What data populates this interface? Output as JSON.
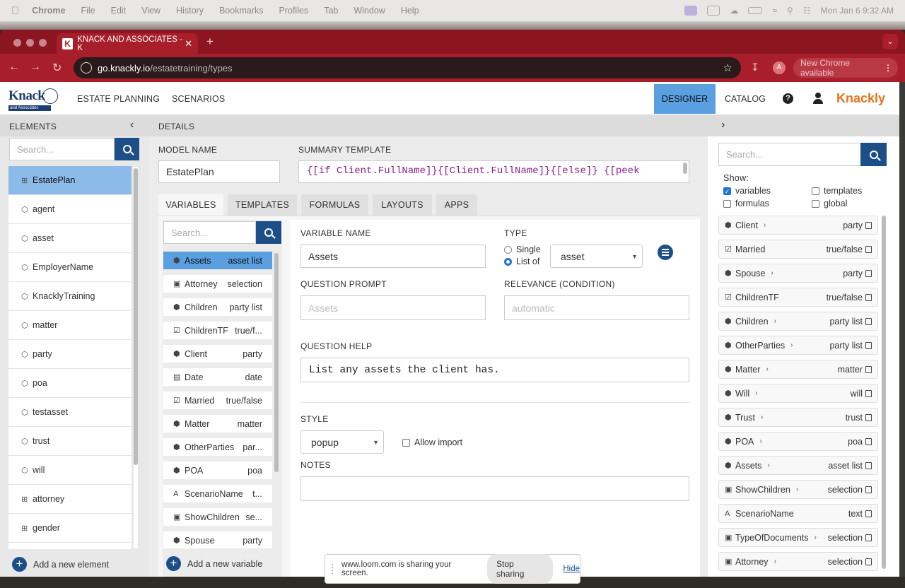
{
  "mac_menu": {
    "app": "Chrome",
    "items": [
      "File",
      "Edit",
      "View",
      "History",
      "Bookmarks",
      "Profiles",
      "Tab",
      "Window",
      "Help"
    ],
    "clock": "Mon Jan 6  9:32 AM"
  },
  "browser": {
    "tab_title": "KNACK AND ASSOCIATES - K",
    "tab_favicon": "K",
    "url_host": "go.knackly.io",
    "url_path": "/estatetraining/types",
    "avatar": "A",
    "update_label": "New Chrome available"
  },
  "header": {
    "logo_main": "Knack",
    "logo_sub": "and Associates",
    "nav": [
      "ESTATE PLANNING",
      "SCENARIOS"
    ],
    "designer": "DESIGNER",
    "catalog": "CATALOG",
    "help": "?",
    "brand": "Knackly"
  },
  "colors": {
    "accent": "#1c4e87",
    "selected": "#5a9fe0",
    "brand": "#e8721c",
    "chrome": "#a81e2a"
  },
  "left": {
    "title": "ELEMENTS",
    "search_placeholder": "Search...",
    "items": [
      {
        "icon": "table-icon",
        "label": "EstatePlan",
        "selected": true
      },
      {
        "icon": "cube-icon",
        "label": "agent"
      },
      {
        "icon": "cube-icon",
        "label": "asset"
      },
      {
        "icon": "cube-icon",
        "label": "EmployerName"
      },
      {
        "icon": "cube-icon",
        "label": "KnacklyTraining"
      },
      {
        "icon": "cube-icon",
        "label": "matter"
      },
      {
        "icon": "cube-icon",
        "label": "party"
      },
      {
        "icon": "cube-icon",
        "label": "poa"
      },
      {
        "icon": "cube-icon",
        "label": "testasset"
      },
      {
        "icon": "cube-icon",
        "label": "trust"
      },
      {
        "icon": "cube-icon",
        "label": "will"
      },
      {
        "icon": "table-icon",
        "label": "attorney"
      },
      {
        "icon": "table-icon",
        "label": "gender"
      }
    ],
    "add_label": "Add a new element"
  },
  "details": {
    "title": "DETAILS",
    "model_name_label": "MODEL NAME",
    "model_name": "EstatePlan",
    "summary_label": "SUMMARY TEMPLATE",
    "summary_line": "{[if Client.FullName]}{[Client.FullName]}{[else]} {[peek",
    "tabs": [
      "VARIABLES",
      "TEMPLATES",
      "FORMULAS",
      "LAYOUTS",
      "APPS"
    ],
    "var_search_placeholder": "Search...",
    "variables": [
      {
        "icon": "cubes-icon",
        "name": "Assets",
        "type": "asset list",
        "selected": true
      },
      {
        "icon": "select-icon",
        "name": "Attorney",
        "type": "selection"
      },
      {
        "icon": "cubes-icon",
        "name": "Children",
        "type": "party list"
      },
      {
        "icon": "check-icon",
        "name": "ChildrenTF",
        "type": "true/f..."
      },
      {
        "icon": "cubes-icon",
        "name": "Client",
        "type": "party"
      },
      {
        "icon": "calendar-icon",
        "name": "Date",
        "type": "date"
      },
      {
        "icon": "check-icon",
        "name": "Married",
        "type": "true/false"
      },
      {
        "icon": "cubes-icon",
        "name": "Matter",
        "type": "matter"
      },
      {
        "icon": "cubes-icon",
        "name": "OtherParties",
        "type": "par..."
      },
      {
        "icon": "cubes-icon",
        "name": "POA",
        "type": "poa"
      },
      {
        "icon": "text-icon",
        "name": "ScenarioName",
        "type": "t..."
      },
      {
        "icon": "select-icon",
        "name": "ShowChildren",
        "type": "se..."
      },
      {
        "icon": "cubes-icon",
        "name": "Spouse",
        "type": "party"
      }
    ],
    "add_var_label": "Add a new variable",
    "editor": {
      "var_name_label": "VARIABLE NAME",
      "var_name": "Assets",
      "type_label": "TYPE",
      "single": "Single",
      "list_of": "List of",
      "type_value": "asset",
      "prompt_label": "QUESTION PROMPT",
      "prompt_placeholder": "Assets",
      "relevance_label": "RELEVANCE (CONDITION)",
      "relevance_placeholder": "automatic",
      "help_label": "QUESTION HELP",
      "help_text": "List any assets the client has.",
      "style_label": "STYLE",
      "style_value": "popup",
      "allow_import": "Allow import",
      "notes_label": "NOTES"
    }
  },
  "right": {
    "search_placeholder": "Search...",
    "show_label": "Show:",
    "filters": [
      {
        "label": "variables",
        "checked": true
      },
      {
        "label": "templates",
        "checked": false
      },
      {
        "label": "formulas",
        "checked": false
      },
      {
        "label": "global",
        "checked": false
      }
    ],
    "items": [
      {
        "icon": "cubes-icon",
        "name": "Client",
        "arrow": true,
        "type": "party"
      },
      {
        "icon": "check-icon",
        "name": "Married",
        "arrow": false,
        "type": "true/false"
      },
      {
        "icon": "cubes-icon",
        "name": "Spouse",
        "arrow": true,
        "type": "party"
      },
      {
        "icon": "check-icon",
        "name": "ChildrenTF",
        "arrow": false,
        "type": "true/false"
      },
      {
        "icon": "cubes-icon",
        "name": "Children",
        "arrow": true,
        "type": "party list"
      },
      {
        "icon": "cubes-icon",
        "name": "OtherParties",
        "arrow": true,
        "type": "party list"
      },
      {
        "icon": "cubes-icon",
        "name": "Matter",
        "arrow": true,
        "type": "matter"
      },
      {
        "icon": "cubes-icon",
        "name": "Will",
        "arrow": true,
        "type": "will"
      },
      {
        "icon": "cubes-icon",
        "name": "Trust",
        "arrow": true,
        "type": "trust"
      },
      {
        "icon": "cubes-icon",
        "name": "POA",
        "arrow": true,
        "type": "poa"
      },
      {
        "icon": "cubes-icon",
        "name": "Assets",
        "arrow": true,
        "type": "asset list"
      },
      {
        "icon": "select-icon",
        "name": "ShowChildren",
        "arrow": true,
        "type": "selection"
      },
      {
        "icon": "text-icon",
        "name": "ScenarioName",
        "arrow": false,
        "type": "text"
      },
      {
        "icon": "select-icon",
        "name": "TypeOfDocuments",
        "arrow": true,
        "type": "selection"
      },
      {
        "icon": "select-icon",
        "name": "Attorney",
        "arrow": true,
        "type": "selection"
      }
    ]
  },
  "loom": {
    "message": "www.loom.com is sharing your screen.",
    "stop": "Stop sharing",
    "hide": "Hide"
  }
}
